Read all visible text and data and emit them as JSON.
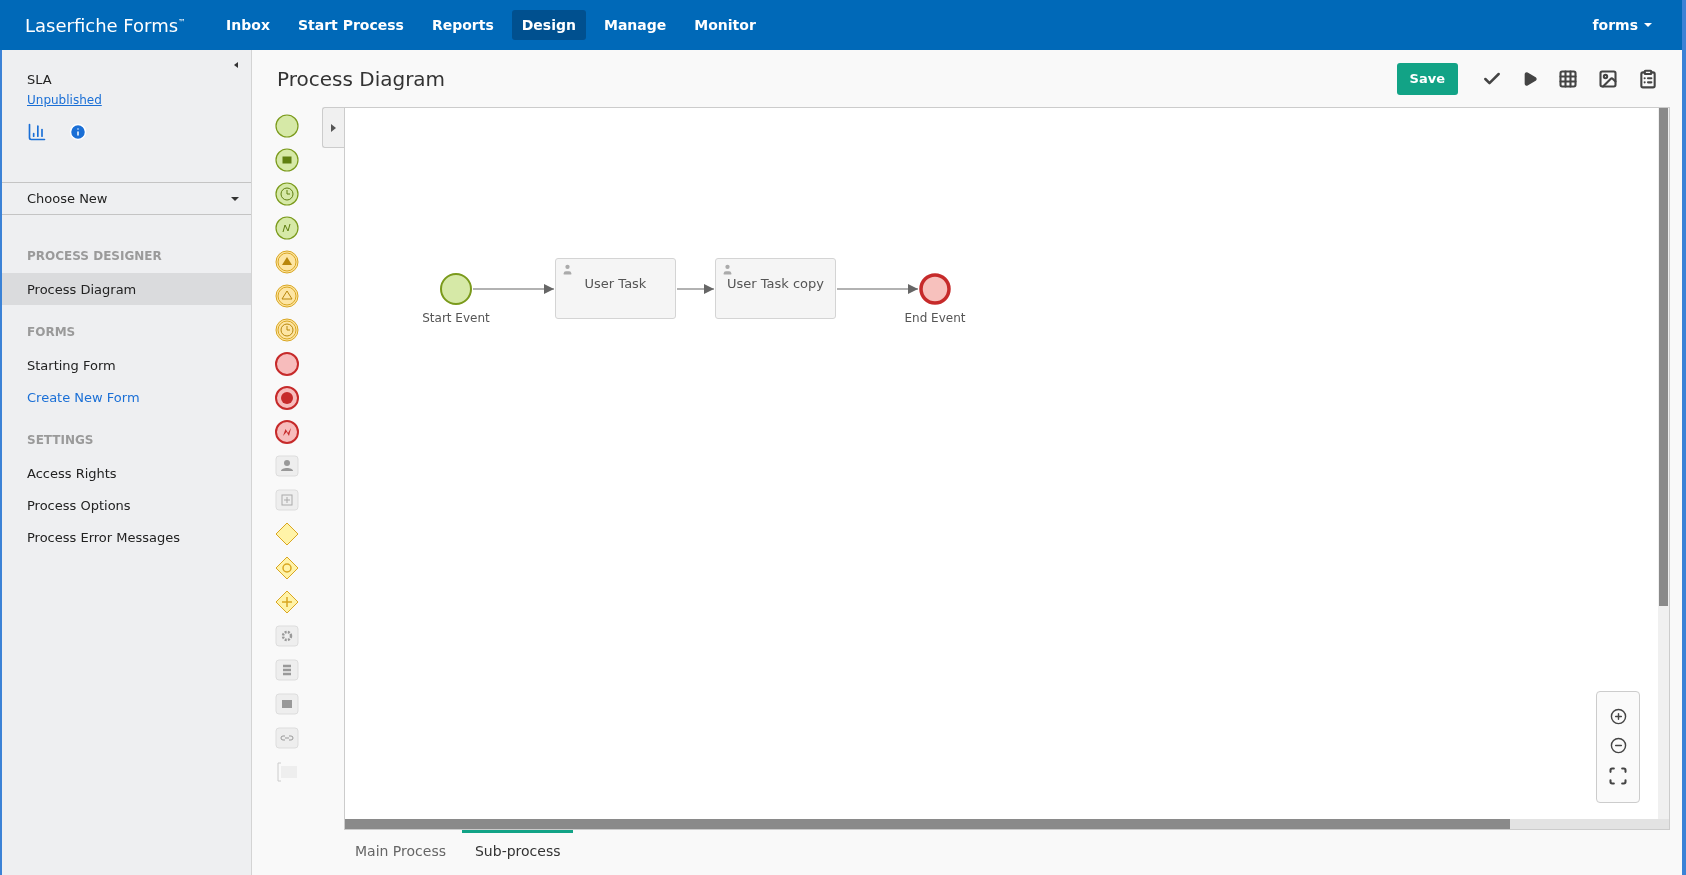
{
  "app": {
    "brand": "Laserfiche Forms$^{™}$",
    "user_menu": "forms"
  },
  "nav": [
    {
      "label": "Inbox",
      "selected": false
    },
    {
      "label": "Start Process",
      "selected": false
    },
    {
      "label": "Reports",
      "selected": false
    },
    {
      "label": "Design",
      "selected": true
    },
    {
      "label": "Manage",
      "selected": false
    },
    {
      "label": "Monitor",
      "selected": false
    }
  ],
  "sidebar": {
    "process_name": "SLA",
    "status": "Unpublished",
    "choose": "Choose New",
    "sections": [
      {
        "heading": "PROCESS DESIGNER",
        "items": [
          {
            "label": "Process Diagram",
            "kind": "item",
            "selected": true
          }
        ]
      },
      {
        "heading": "FORMS",
        "items": [
          {
            "label": "Starting Form",
            "kind": "item",
            "selected": false
          },
          {
            "label": "Create New Form",
            "kind": "link",
            "selected": false
          }
        ]
      },
      {
        "heading": "SETTINGS",
        "items": [
          {
            "label": "Access Rights",
            "kind": "item",
            "selected": false
          },
          {
            "label": "Process Options",
            "kind": "item",
            "selected": false
          },
          {
            "label": "Process Error Messages",
            "kind": "item",
            "selected": false
          }
        ]
      }
    ]
  },
  "page": {
    "title": "Process Diagram",
    "save": "Save"
  },
  "diagram": {
    "nodes": [
      {
        "kind": "start",
        "label": "Start Event"
      },
      {
        "kind": "task",
        "label": "User Task"
      },
      {
        "kind": "task",
        "label": "User Task copy"
      },
      {
        "kind": "end",
        "label": "End Event"
      }
    ]
  },
  "bottom_tabs": [
    {
      "label": "Main Process",
      "selected": false
    },
    {
      "label": "Sub-process",
      "selected": true
    }
  ]
}
